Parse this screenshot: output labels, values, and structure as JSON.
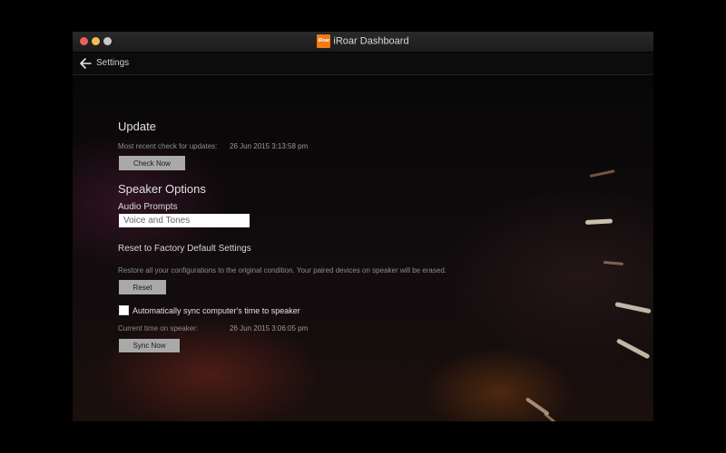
{
  "window": {
    "title": "iRoar Dashboard",
    "app_logo_text": "iRoar"
  },
  "nav": {
    "title": "Settings"
  },
  "update": {
    "heading": "Update",
    "last_check_label": "Most recent check for updates:",
    "last_check_value": "26 Jun 2015 3:13:58 pm",
    "check_button": "Check Now"
  },
  "speaker": {
    "heading": "Speaker Options",
    "audio_prompts_label": "Audio Prompts",
    "audio_prompts_value": "Voice and Tones"
  },
  "reset": {
    "heading": "Reset to Factory Default Settings",
    "description": "Restore all your configurations to the original condition. Your paired devices on speaker will be erased.",
    "button": "Reset"
  },
  "sync": {
    "checkbox_label": "Automatically sync computer's time to speaker",
    "checked": false,
    "current_time_label": "Current time on speaker:",
    "current_time_value": "26 Jun 2015 3:06:05 pm",
    "button": "Sync Now"
  },
  "colors": {
    "accent": "#f07a14",
    "button_bg": "#a9a9a9",
    "window_bg": "#0b0a0b"
  }
}
